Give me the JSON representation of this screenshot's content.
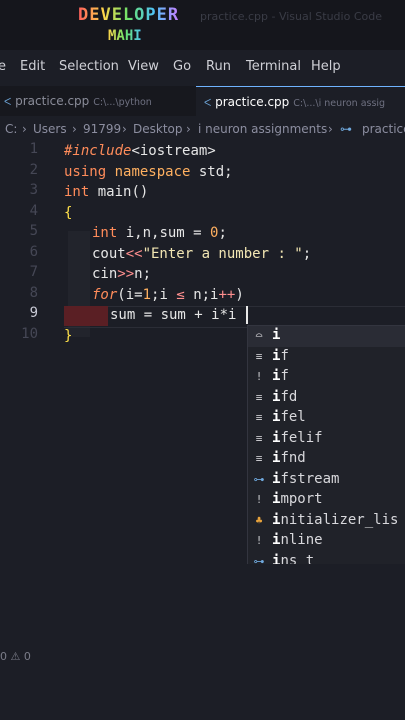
{
  "watermark": {
    "line1": "DEVELOPER",
    "line2": "MAHI"
  },
  "window_title": "practice.cpp - Visual Studio Code",
  "menu": [
    "e",
    "Edit",
    "Selection",
    "View",
    "Go",
    "Run",
    "Terminal",
    "Help"
  ],
  "tabs": [
    {
      "name": "practice.cpp",
      "path": "C:\\...\\python",
      "active": false
    },
    {
      "name": "practice.cpp",
      "path": "C:\\...\\i neuron assig",
      "active": true
    }
  ],
  "breadcrumbs": [
    "C:",
    "Users",
    "91799",
    "Desktop",
    "i neuron assignments",
    "practice"
  ],
  "line_numbers": [
    "1",
    "2",
    "3",
    "4",
    "5",
    "6",
    "7",
    "8",
    "9",
    "10"
  ],
  "current_line": "9",
  "code": {
    "l1_a": "#include",
    "l1_b": "<iostream>",
    "l2_a": "using",
    "l2_b": " namespace",
    "l2_c": " std;",
    "l3_a": "int",
    "l3_b": " main()",
    "l4": "{",
    "l5_a": "int",
    "l5_b": " i,n,sum = ",
    "l5_c": "0",
    "l5_d": ";",
    "l6_a": "cout",
    "l6_b": "<<",
    "l6_c": "\"Enter a number : \"",
    "l6_d": ";",
    "l7_a": "cin",
    "l7_b": ">>",
    "l7_c": "n;",
    "l8_a": "for",
    "l8_b": "(i=",
    "l8_c": "1",
    "l8_d": ";i ",
    "l8_e": "≤",
    "l8_f": " n;i",
    "l8_g": "++",
    "l8_h": ")",
    "l9": "sum = sum + i*i",
    "l10": "}"
  },
  "suggestions": [
    {
      "icon": "keyword-icon",
      "glyph": "⌓",
      "match": "i",
      "rest": ""
    },
    {
      "icon": "snippet-icon",
      "glyph": "≡",
      "match": "i",
      "rest": "f"
    },
    {
      "icon": "keyword-icon",
      "glyph": "!",
      "match": "i",
      "rest": "f"
    },
    {
      "icon": "snippet-icon",
      "glyph": "≡",
      "match": "i",
      "rest": "fd"
    },
    {
      "icon": "snippet-icon",
      "glyph": "≡",
      "match": "i",
      "rest": "fel"
    },
    {
      "icon": "snippet-icon",
      "glyph": "≡",
      "match": "i",
      "rest": "felif"
    },
    {
      "icon": "snippet-icon",
      "glyph": "≡",
      "match": "i",
      "rest": "fnd"
    },
    {
      "icon": "variable-icon",
      "glyph": "⊶",
      "match": "i",
      "rest": "fstream"
    },
    {
      "icon": "keyword-icon",
      "glyph": "!",
      "match": "i",
      "rest": "mport"
    },
    {
      "icon": "class-icon",
      "glyph": "♣",
      "match": "i",
      "rest": "nitializer_lis"
    },
    {
      "icon": "keyword-icon",
      "glyph": "!",
      "match": "i",
      "rest": "nline"
    },
    {
      "icon": "variable-icon",
      "glyph": "⊶",
      "match": "i",
      "rest": "ns t"
    }
  ],
  "status": {
    "errors": "0",
    "warnings": "0",
    "problems_text": "0 ⚠ 0"
  },
  "colors": {
    "keyword": "#ff8c5a",
    "string": "#f2e6b3",
    "brace": "#ffe14a",
    "background": "#1c1e26"
  }
}
